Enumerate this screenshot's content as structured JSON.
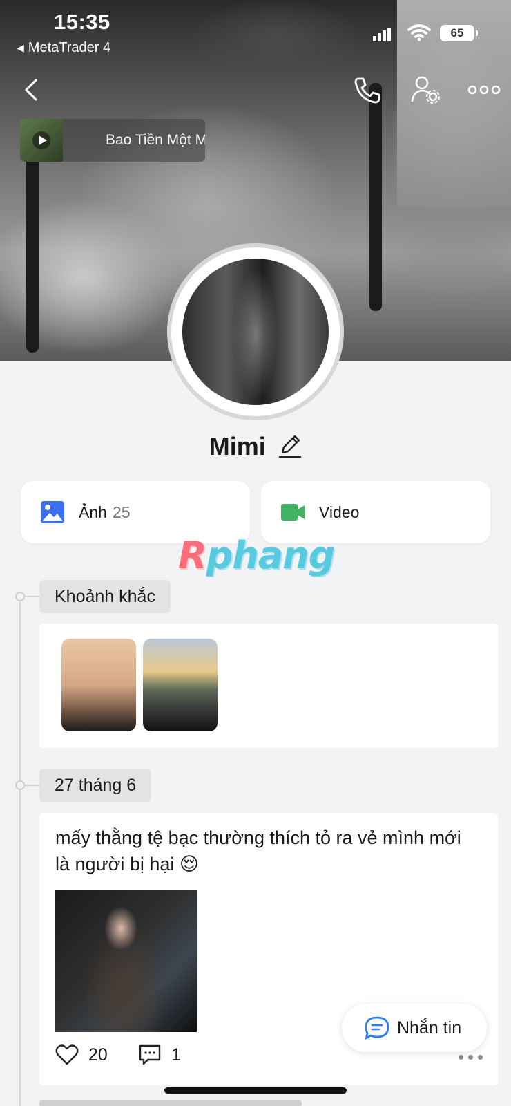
{
  "status_bar": {
    "time": "15:35",
    "back_app": "MetaTrader 4",
    "battery": "65"
  },
  "header": {
    "music_title": "Bao Tiền Một Mớ"
  },
  "profile": {
    "name": "Mimi"
  },
  "media": {
    "photos_label": "Ảnh",
    "photos_count": "25",
    "video_label": "Video"
  },
  "watermark": {
    "r": "R",
    "rest": "phang"
  },
  "timeline": {
    "moments_label": "Khoảnh khắc",
    "date_label": "27 tháng 6"
  },
  "post": {
    "text": "mấy thằng tệ bạc thường thích tỏ ra vẻ mình mới là người bị hại 😌",
    "likes": "20",
    "comments": "1"
  },
  "message_button": {
    "label": "Nhắn tin"
  },
  "colors": {
    "photo_icon": "#3a6ff0",
    "video_icon": "#3fb35f",
    "message_icon": "#2f7cf6",
    "page_bg": "#f2f3f5"
  }
}
